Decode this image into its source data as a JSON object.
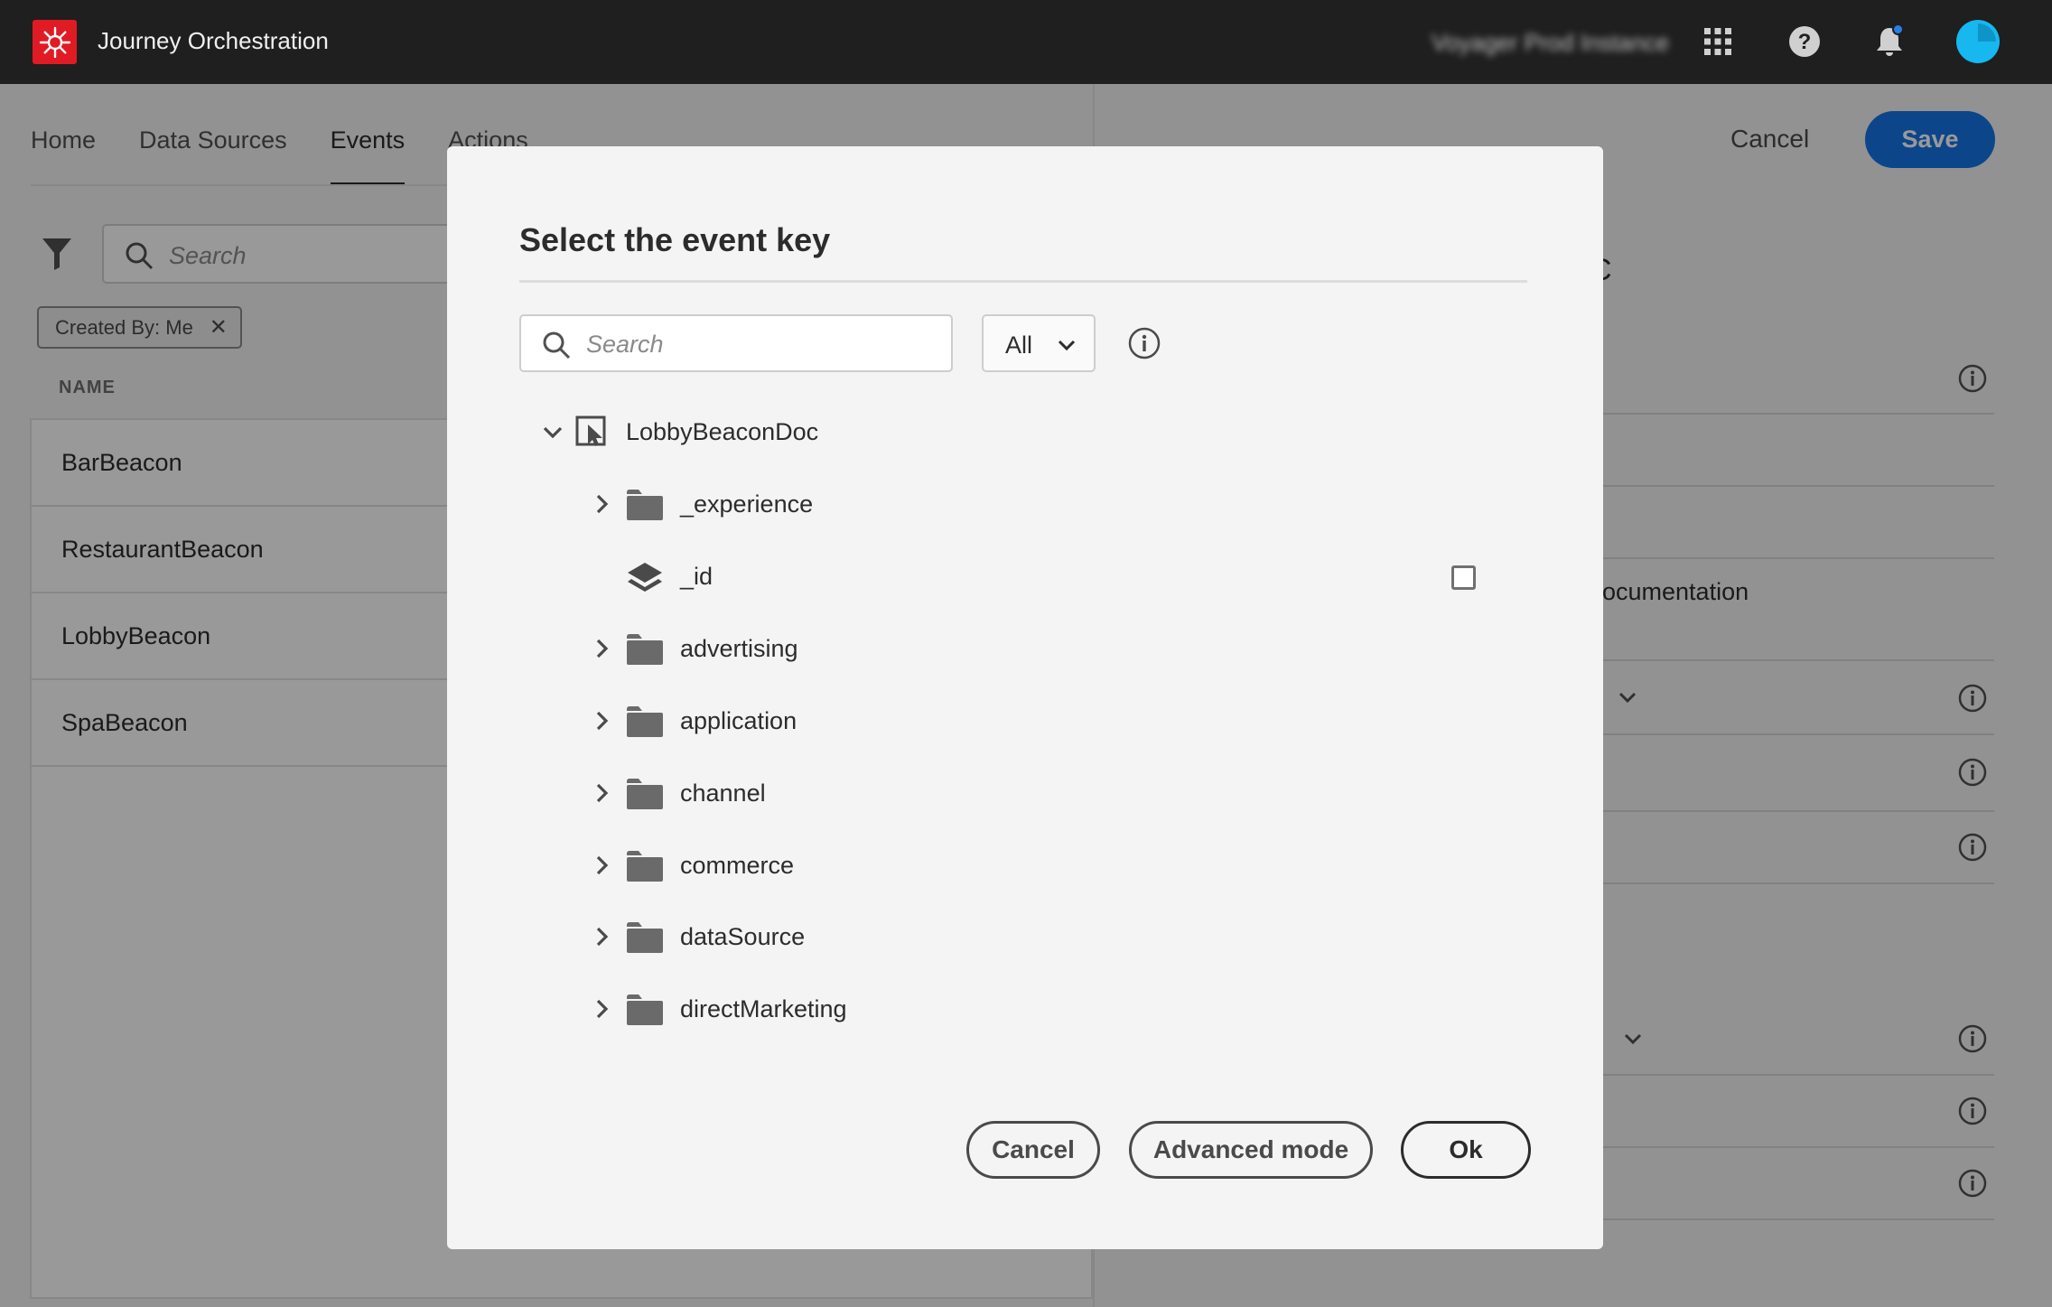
{
  "header": {
    "app_title": "Journey Orchestration",
    "instance_name": "Voyager Prod Instance",
    "icons": [
      "app-grid-icon",
      "help-icon",
      "bell-icon",
      "avatar"
    ]
  },
  "nav": {
    "tabs": [
      {
        "label": "Home"
      },
      {
        "label": "Data Sources"
      },
      {
        "label": "Events"
      },
      {
        "label": "Actions"
      }
    ],
    "active_tab": "Events"
  },
  "events_list": {
    "search_placeholder": "Search",
    "filter_chip": "Created By: Me",
    "column_header": "NAME",
    "rows": [
      "BarBeacon",
      "RestaurantBeacon",
      "LobbyBeacon",
      "SpaBeacon"
    ]
  },
  "detail_panel": {
    "cancel_label": "Cancel",
    "save_label": "Save",
    "partial_title": "C",
    "partial_text": "locumentation"
  },
  "modal": {
    "title": "Select the event key",
    "search_placeholder": "Search",
    "filter_value": "All",
    "tree": {
      "root": "LobbyBeaconDoc",
      "children": [
        {
          "label": "_experience",
          "type": "folder"
        },
        {
          "label": "_id",
          "type": "field"
        },
        {
          "label": "advertising",
          "type": "folder"
        },
        {
          "label": "application",
          "type": "folder"
        },
        {
          "label": "channel",
          "type": "folder"
        },
        {
          "label": "commerce",
          "type": "folder"
        },
        {
          "label": "dataSource",
          "type": "folder"
        },
        {
          "label": "directMarketing",
          "type": "folder"
        }
      ]
    },
    "buttons": {
      "cancel": "Cancel",
      "advanced": "Advanced mode",
      "ok": "Ok"
    }
  },
  "colors": {
    "topbar": "#1f1f1f",
    "brand_red": "#e01b24",
    "accent_blue": "#1473e6",
    "avatar": "#17b7f0"
  }
}
